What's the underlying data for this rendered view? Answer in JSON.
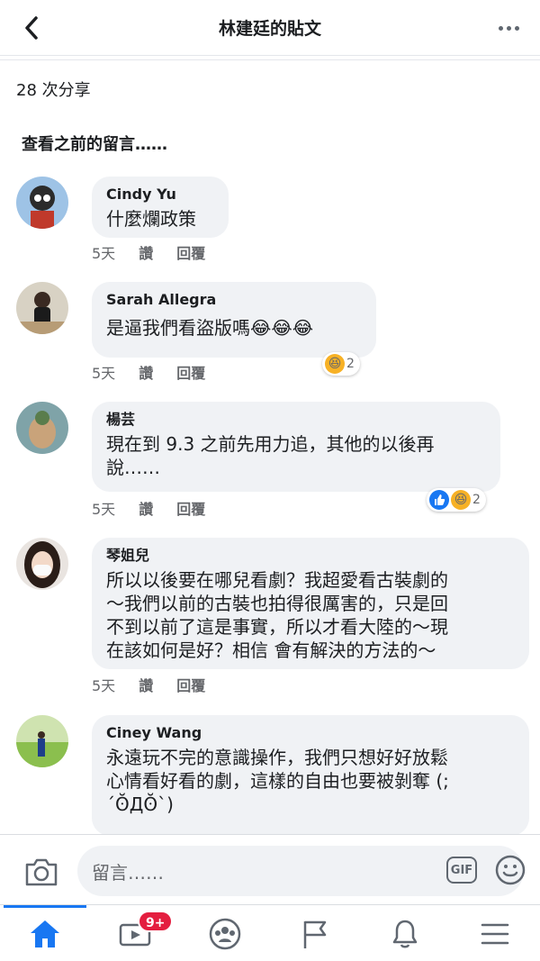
{
  "header": {
    "title": "林建廷的貼文"
  },
  "shares": "28 次分享",
  "prev_comments": "查看之前的留言……",
  "comments": [
    {
      "name": "Cindy Yu",
      "text": "什麼爛政策",
      "time": "5天",
      "like": "讚",
      "reply": "回覆"
    },
    {
      "name": "Sarah Allegra",
      "text": "是逼我們看盜版嗎😂😂😂",
      "time": "5天",
      "like": "讚",
      "reply": "回覆",
      "reaction_count": "2"
    },
    {
      "name": "楊芸",
      "text": "現在到 9.3 之前先用力追，其他的以後再\n說……",
      "time": "5天",
      "like": "讚",
      "reply": "回覆",
      "reaction_count": "2"
    },
    {
      "name": "琴姐兒",
      "text": "所以以後要在哪兒看劇？我超愛看古裝劇的\n～我們以前的古裝也拍得很厲害的，只是回\n不到以前了這是事實，所以才看大陸的～現\n在該如何是好？相信 會有解決的方法的～",
      "time": "5天",
      "like": "讚",
      "reply": "回覆"
    },
    {
      "name": "Ciney Wang",
      "text": "永遠玩不完的意識操作，我們只想好好放鬆\n心情看好看的劇，這樣的自由也要被剝奪 (;\n´ʘ̆Дʘ̆`)"
    }
  ],
  "composer": {
    "placeholder": "留言……",
    "gif": "GIF"
  },
  "tabbar": {
    "video_badge": "9+"
  },
  "colors": {
    "accent": "#1877f2",
    "bubble": "#f0f2f5",
    "badge": "#e41e3f"
  }
}
